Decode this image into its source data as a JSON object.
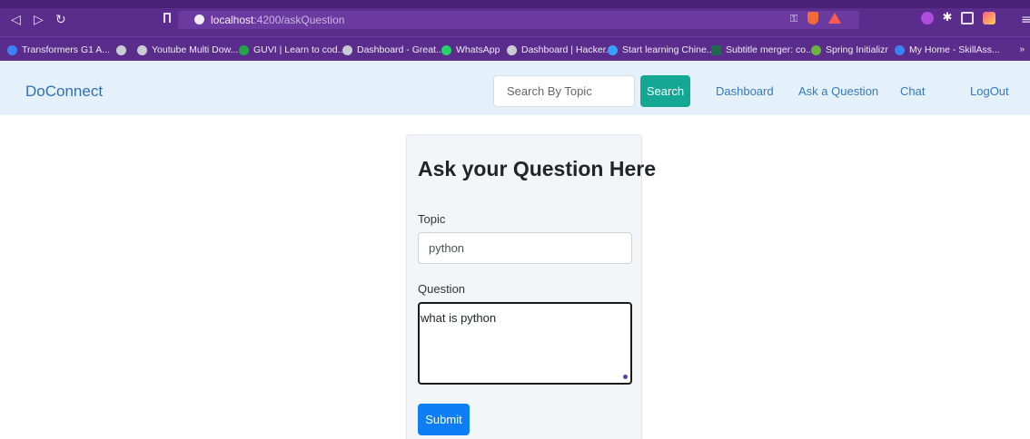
{
  "browser": {
    "back_icon": "back-arrow-icon",
    "forward_icon": "forward-arrow-icon",
    "reload_icon": "reload-icon",
    "url_host": "localhost",
    "url_path": ":4200/askQuestion",
    "bookmarks": [
      {
        "label": "Transformers G1 A...",
        "color": "#3b82f6"
      },
      {
        "label": "",
        "color": "#9aa0a6"
      },
      {
        "label": "Youtube Multi Dow...",
        "color": "#9aa0a6"
      },
      {
        "label": "GUVI | Learn to cod...",
        "color": "#22a447"
      },
      {
        "label": "Dashboard - Great...",
        "color": "#9aa0a6"
      },
      {
        "label": "WhatsApp",
        "color": "#25d366"
      },
      {
        "label": "Dashboard | Hacker...",
        "color": "#9aa0a6"
      },
      {
        "label": "Start learning Chine...",
        "color": "#3aa0ff"
      },
      {
        "label": "Subtitle merger: co...",
        "color": "#1c6b4a"
      },
      {
        "label": "Spring Initializr",
        "color": "#6db33f"
      },
      {
        "label": "My Home - SkillAss...",
        "color": "#3b82f6"
      }
    ],
    "more": "»"
  },
  "navbar": {
    "brand": "DoConnect",
    "search_placeholder": "Search By Topic",
    "search_button": "Search",
    "links": [
      "Dashboard",
      "Ask a Question",
      "Chat",
      "LogOut"
    ]
  },
  "form": {
    "title": "Ask your Question Here",
    "topic_label": "Topic",
    "topic_value": "python",
    "question_label": "Question",
    "question_value": "what is python",
    "submit_label": "Submit"
  },
  "colors": {
    "browser_chrome": "#5a2d8c",
    "navbar_bg": "#e4f1fb",
    "brand": "#2f6fb3",
    "search_button": "#14a894",
    "submit_button": "#0d7ef5"
  }
}
